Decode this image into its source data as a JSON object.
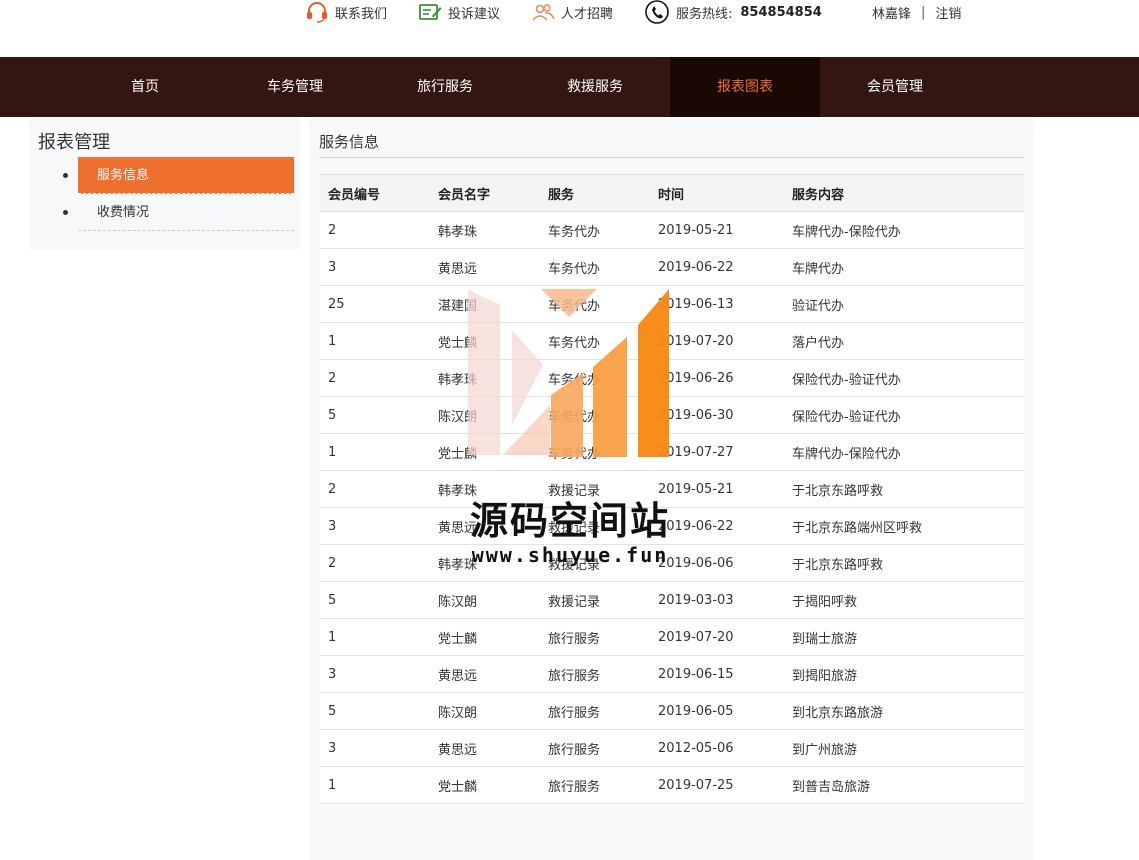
{
  "topbar": {
    "contact": "联系我们",
    "complaint": "投诉建议",
    "recruit": "人才招聘",
    "hotline_label": "服务热线:",
    "hotline_number": "854854854",
    "username": "林嘉锋",
    "separator": "|",
    "logout": "注销"
  },
  "nav": {
    "items": [
      "首页",
      "车务管理",
      "旅行服务",
      "救援服务",
      "报表图表",
      "会员管理"
    ],
    "active_index": 4
  },
  "sidebar": {
    "title": "报表管理",
    "items": [
      "服务信息",
      "收费情况"
    ],
    "active_index": 0
  },
  "content": {
    "title": "服务信息",
    "columns": [
      "会员编号",
      "会员名字",
      "服务",
      "时间",
      "服务内容"
    ],
    "rows": [
      [
        "2",
        "韩孝珠",
        "车务代办",
        "2019-05-21",
        "车牌代办-保险代办"
      ],
      [
        "3",
        "黄思远",
        "车务代办",
        "2019-06-22",
        "车牌代办"
      ],
      [
        "25",
        "湛建国",
        "车务代办",
        "2019-06-13",
        "验证代办"
      ],
      [
        "1",
        "党士麟",
        "车务代办",
        "2019-07-20",
        "落户代办"
      ],
      [
        "2",
        "韩孝珠",
        "车务代办",
        "2019-06-26",
        "保险代办-验证代办"
      ],
      [
        "5",
        "陈汉朗",
        "车务代办",
        "2019-06-30",
        "保险代办-验证代办"
      ],
      [
        "1",
        "党士麟",
        "车务代办",
        "2019-07-27",
        "车牌代办-保险代办"
      ],
      [
        "2",
        "韩孝珠",
        "救援记录",
        "2019-05-21",
        "于北京东路呼救"
      ],
      [
        "3",
        "黄思远",
        "救援记录",
        "2019-06-22",
        "于北京东路端州区呼救"
      ],
      [
        "2",
        "韩孝珠",
        "救援记录",
        "2019-06-06",
        "于北京东路呼救"
      ],
      [
        "5",
        "陈汉朗",
        "救援记录",
        "2019-03-03",
        "于揭阳呼救"
      ],
      [
        "1",
        "党士麟",
        "旅行服务",
        "2019-07-20",
        "到瑞士旅游"
      ],
      [
        "3",
        "黄思远",
        "旅行服务",
        "2019-06-15",
        "到揭阳旅游"
      ],
      [
        "5",
        "陈汉朗",
        "旅行服务",
        "2019-06-05",
        "到北京东路旅游"
      ],
      [
        "3",
        "黄思远",
        "旅行服务",
        "2012-05-06",
        "到广州旅游"
      ],
      [
        "1",
        "党士麟",
        "旅行服务",
        "2019-07-25",
        "到普吉岛旅游"
      ]
    ]
  },
  "watermark": {
    "title": "源码空间站",
    "url": "www.shuyue.fun"
  },
  "colors": {
    "nav_bg": "#33160f",
    "nav_active_bg": "#1a0805",
    "accent": "#ef6f2e",
    "panel_bg": "#f7f8fa"
  },
  "icons": {
    "contact": "headset-icon",
    "complaint": "edit-note-icon",
    "recruit": "people-icon",
    "hotline": "phone-icon"
  }
}
